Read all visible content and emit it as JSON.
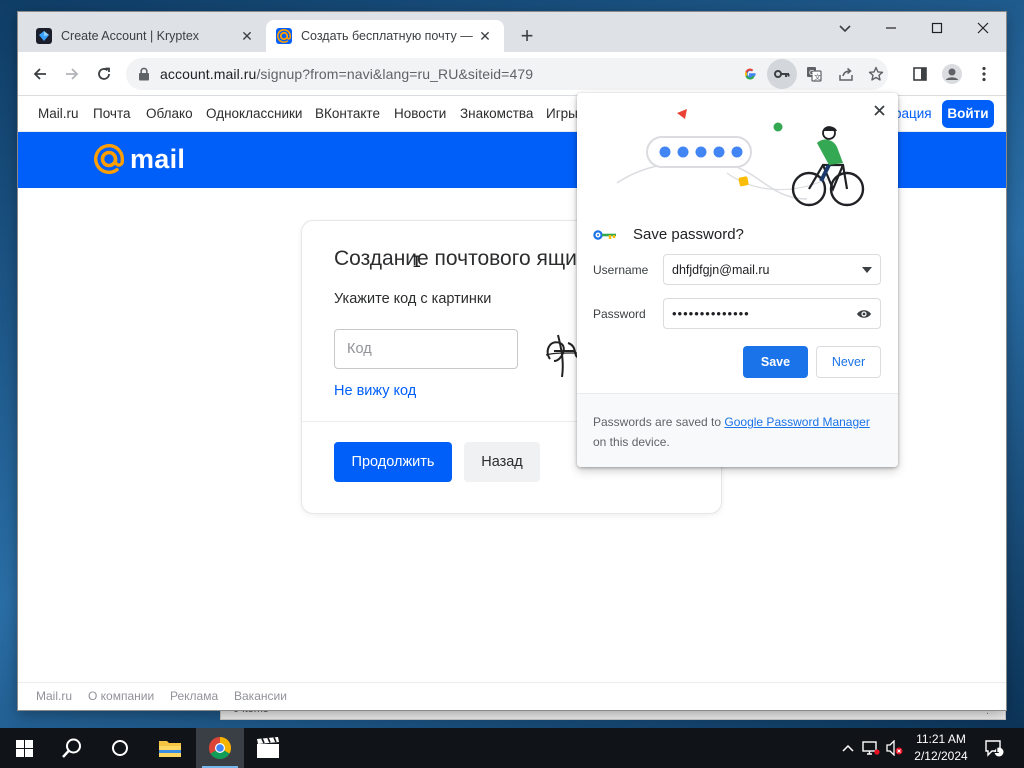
{
  "browser": {
    "tabs": [
      {
        "title": "Create Account | Kryptex",
        "close": "✕"
      },
      {
        "title": "Создать бесплатную почту — Mail.ru",
        "close": "✕"
      }
    ],
    "new_tab": "+",
    "url_host": "account.mail.ru",
    "url_rest": "/signup?from=navi&lang=ru_RU&siteid=479"
  },
  "portal_nav": {
    "items": [
      "Mail.ru",
      "Почта",
      "Облако",
      "Одноклассники",
      "ВКонтакте",
      "Новости",
      "Знакомства",
      "Игры"
    ],
    "registration_partial": "рация",
    "login": "Войти"
  },
  "header": {
    "logo_text": "mail"
  },
  "signup": {
    "title": "Создание почтового ящика",
    "subtitle": "Укажите код с картинки",
    "code_placeholder": "Код",
    "no_code_link": "Не вижу код",
    "continue": "Продолжить",
    "back": "Назад"
  },
  "footer": {
    "links": [
      "Mail.ru",
      "О компании",
      "Реклама",
      "Вакансии"
    ]
  },
  "password_bubble": {
    "title": "Save password?",
    "username_label": "Username",
    "username_value": "dhfjdfgjn@mail.ru",
    "password_label": "Password",
    "password_masked": "••••••••••••••",
    "save": "Save",
    "never": "Never",
    "footer_prefix": "Passwords are saved to ",
    "footer_link": "Google Password Manager",
    "footer_suffix": " on this device."
  },
  "background_window": {
    "status_text": "0 items"
  },
  "taskbar": {
    "time": "11:21 AM",
    "date": "2/12/2024",
    "notification_count": "1"
  },
  "colors": {
    "mail_blue": "#005ff9",
    "chrome_blue": "#1a73e8",
    "mail_orange": "#ff9e00"
  },
  "icons": [
    "back-arrow-icon",
    "forward-arrow-icon",
    "reload-icon",
    "lock-icon",
    "google-icon",
    "key-icon",
    "translate-icon",
    "share-icon",
    "star-icon",
    "sidebar-icon",
    "profile-icon",
    "menu-icon",
    "windows-start-icon",
    "search-icon",
    "task-view-icon",
    "file-explorer-icon",
    "chrome-icon",
    "media-icon",
    "chevron-up-icon",
    "network-icon",
    "volume-muted-icon",
    "notification-icon"
  ]
}
